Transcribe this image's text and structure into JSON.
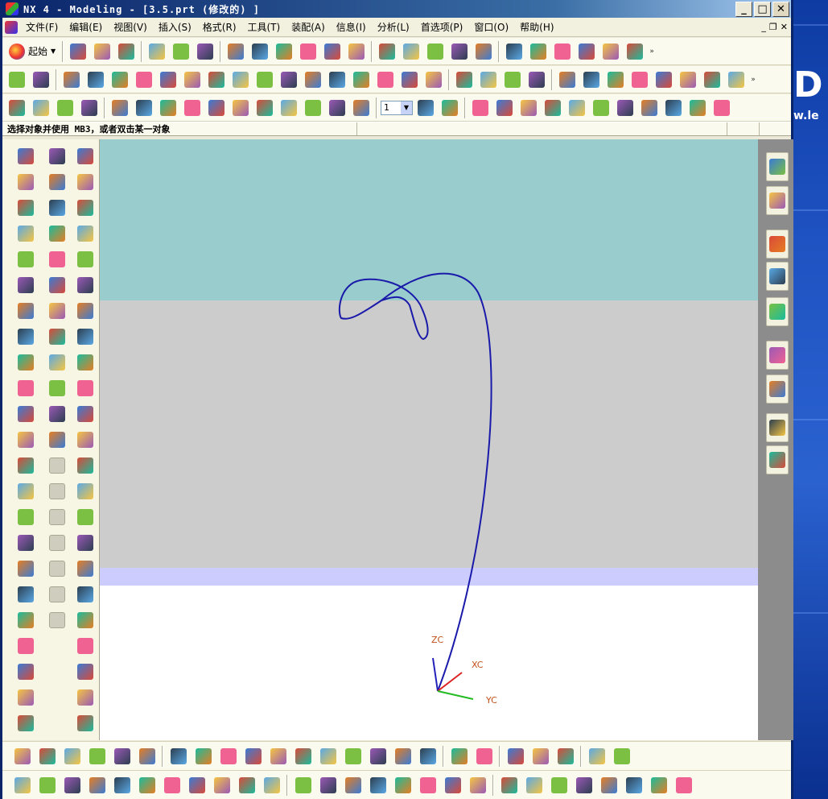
{
  "window": {
    "title": "NX 4 - Modeling - [3.5.prt  (修改的) ]"
  },
  "window_controls": {
    "minimize": "_",
    "maximize": "□",
    "close": "✕"
  },
  "menu": [
    "文件(F)",
    "编辑(E)",
    "视图(V)",
    "插入(S)",
    "格式(R)",
    "工具(T)",
    "装配(A)",
    "信息(I)",
    "分析(L)",
    "首选项(P)",
    "窗口(O)",
    "帮助(H)"
  ],
  "mdi_controls": {
    "minimize": "_",
    "restore": "❐",
    "close": "✕"
  },
  "toolbar": {
    "start_label": "起始",
    "layer_value": "1"
  },
  "status": {
    "prompt": "选择对象并使用 MB3，或者双击某一对象"
  },
  "viewport": {
    "colors": {
      "top": "#99cccc",
      "middle": "#cccccc",
      "band": "#ccccff",
      "bottom": "#ffffff",
      "curve": "#1a1aaa"
    },
    "axes": {
      "zc": "ZC",
      "xc": "XC",
      "yc": "YC"
    }
  },
  "desktop": {
    "logo": "D",
    "url": "w.le"
  },
  "icons": {
    "row1": [
      "new-file-icon",
      "open-folder-icon",
      "save-icon",
      "cut-icon",
      "copy-icon",
      "paste-icon",
      "fit-icon",
      "zoom-window-icon",
      "zoom-icon",
      "rotate-icon",
      "pan-icon",
      "perspective-icon",
      "iso-view-icon",
      "front-view-icon",
      "top-view-icon",
      "right-view-icon",
      "wireframe-icon",
      "measure-distance-icon",
      "measure-angle-icon",
      "ruler-icon",
      "protractor-icon",
      "sheet-analysis-icon",
      "surface-analysis-icon"
    ],
    "row2": [
      "part-navigator-icon",
      "layers-icon",
      "feature-icon",
      "sweep-icon",
      "tube-icon",
      "block-icon",
      "cylinder-icon",
      "cone-icon",
      "sphere-icon",
      "boss-icon",
      "pocket-icon",
      "pad-icon",
      "slot-icon",
      "groove-icon",
      "hole-icon",
      "thread-icon",
      "trim-body-icon",
      "split-body-icon",
      "blend-icon",
      "chamfer-icon",
      "shell-icon",
      "offset-face-icon",
      "scale-icon",
      "pattern-icon",
      "mirror-icon",
      "datum-plane-icon",
      "point-set-icon",
      "p4-icon",
      "extract-icon",
      "draft-icon"
    ],
    "row3": [
      "unite-icon",
      "subtract-icon",
      "intersect-icon",
      "sew-icon",
      "patch-icon",
      "face-blend-icon",
      "soft-blend-icon",
      "curve-network-icon",
      "bridge-icon",
      "edge-blend-icon",
      "spline-icon",
      "through-curves-icon",
      "box-icon",
      "body-list-icon",
      "layer-combo-icon",
      "work-layer-icon",
      "layer-visible-icon",
      "wcs-icon",
      "wcs-origin-icon",
      "wcs-rotate-icon",
      "wcs-dynamic-icon",
      "wcs-orient-icon",
      "wcs-save-icon",
      "display-wcs-icon",
      "color-edit-icon",
      "edit-display-icon",
      "show-hide-icon",
      "hide-icon",
      "blank-icon",
      "unblank-icon"
    ],
    "left1": [
      "line-icon",
      "arc-icon",
      "circle-icon",
      "point-circle-icon",
      "basic-curves-icon",
      "text-icon",
      "point-icon",
      "point-set-icon",
      "chamfer-icon",
      "rectangle-icon",
      "polygon-icon",
      "ellipse-icon",
      "general-conic-icon",
      "spline-icon",
      "helix-icon",
      "law-curve-icon",
      "offset-curve-icon",
      "bridge-curve-icon",
      "project-curve-icon",
      "intersection-curve-icon",
      "section-curve-icon",
      "extract-curve-icon",
      "combined-curve-icon",
      "wrap-curve-icon"
    ],
    "left2": [
      "trim-curve-icon",
      "trim-corner-icon",
      "divide-curve-icon",
      "fillet-icon",
      "edit-arc-icon",
      "edit-length-icon",
      "stretch-icon",
      "edit-param-icon",
      "offset-icon",
      "edit-fillet-icon",
      "edit-chamfer-icon",
      "smooth-spline-icon",
      "line-disabled-icon",
      "line-2-disabled-icon",
      "arc-disabled-icon",
      "tangent-disabled-icon",
      "circle-disabled-icon",
      "circle-2-disabled-icon",
      "cross-disabled-icon"
    ],
    "left3": [
      "through-points-icon",
      "through-poles-icon",
      "from-cloud-icon",
      "ruled-icon",
      "through-curves-icon",
      "through-mesh-icon",
      "swept-icon",
      "section-icon",
      "bridge-surface-icon",
      "n-sided-icon",
      "extension-icon",
      "offset-surface-icon",
      "transition-icon",
      "enlarge-icon",
      "quilt-icon",
      "trimmed-sheet-icon",
      "fillet-surface-icon",
      "patch-surface-icon",
      "global-shape-icon",
      "foil-icon",
      "bounded-plane-icon",
      "thicken-icon",
      "sheet-to-solid-icon",
      "x-form-icon",
      "midsurface-icon"
    ],
    "right": [
      "assembly-navigator-icon",
      "part-navigator-icon",
      "web-browser-icon",
      "training-icon",
      "help-icon",
      "history-icon",
      "system-materials-icon",
      "process-studio-icon",
      "roles-icon"
    ],
    "bottom1": [
      "add-component-icon",
      "new-component-icon",
      "new-parent-icon",
      "create-array-icon",
      "mirror-assembly-icon",
      "replace-component-icon",
      "mate-component-icon",
      "reposition-component-icon",
      "assembly-constraints-icon",
      "move-component-icon",
      "wave-geometry-linker-icon",
      "exploded-view-icon",
      "explode-component-icon",
      "unexplode-icon",
      "delete-explode-icon",
      "hide-view-icon",
      "show-view-icon",
      "assembly-cut-icon",
      "sequence-icon",
      "reference-set-icon",
      "clearance-icon",
      "product-interface-icon",
      "interpart-link-icon",
      "check-parts-icon"
    ],
    "bottom2": [
      "clamp-icon",
      "clamp-2-icon",
      "rod-icon",
      "t-slot-icon",
      "fixture-icon",
      "pin-icon",
      "bolt-icon",
      "knob-icon",
      "diamond-icon",
      "connector-icon",
      "valve-icon",
      "torus-icon",
      "ring-icon",
      "washer-icon",
      "oring-icon",
      "gear-icon",
      "key-icon",
      "bracket-icon",
      "bearing-icon",
      "pill-icon",
      "square-nut-icon",
      "chain-icon",
      "mold-icon",
      "tool-icon",
      "camera-icon",
      "sphere-icon",
      "grommet-icon"
    ]
  },
  "icon_colors": [
    "#3a7bd5",
    "#f5c542",
    "#d94a38",
    "#5aa9e6",
    "#7bc043",
    "#9b59b6",
    "#e67e22",
    "#2c3e50",
    "#1abc9c",
    "#f06292"
  ]
}
